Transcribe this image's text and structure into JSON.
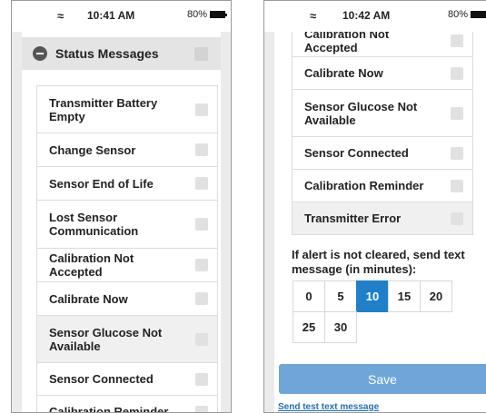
{
  "left_screen": {
    "status_bar": {
      "wifi_icon": "wifi-icon",
      "time": "10:41 AM",
      "battery": "80%"
    },
    "section": {
      "title": "Status Messages",
      "icon": "minus-circle-icon"
    },
    "items": [
      {
        "label": "Transmitter Battery Empty",
        "checked": false
      },
      {
        "label": "Change Sensor",
        "checked": false
      },
      {
        "label": "Sensor End of Life",
        "checked": false
      },
      {
        "label": "Lost Sensor Communication",
        "checked": false
      },
      {
        "label": "Calibration Not Accepted",
        "checked": false
      },
      {
        "label": "Calibrate Now",
        "checked": false
      },
      {
        "label": "Sensor Glucose Not Available",
        "checked": false
      },
      {
        "label": "Sensor Connected",
        "checked": false
      },
      {
        "label": "Calibration Reminder",
        "checked": false
      }
    ]
  },
  "right_screen": {
    "status_bar": {
      "wifi_icon": "wifi-icon",
      "time": "10:42 AM",
      "battery": "80%"
    },
    "items": [
      {
        "label": "Calibration Not Accepted",
        "checked": false
      },
      {
        "label": "Calibrate Now",
        "checked": false
      },
      {
        "label": "Sensor Glucose Not Available",
        "checked": false
      },
      {
        "label": "Sensor Connected",
        "checked": false
      },
      {
        "label": "Calibration Reminder",
        "checked": false
      },
      {
        "label": "Transmitter Error",
        "checked": false
      }
    ],
    "alert_prompt": "If alert is not cleared, send text message (in minutes):",
    "minute_options": [
      "0",
      "5",
      "10",
      "15",
      "20",
      "25",
      "30"
    ],
    "selected_minutes": "10",
    "save_label": "Save",
    "test_link": "Send test text message"
  },
  "colors": {
    "accent": "#1f7fc9",
    "save_button": "#6fa6d9",
    "link": "#1f6fb8"
  }
}
